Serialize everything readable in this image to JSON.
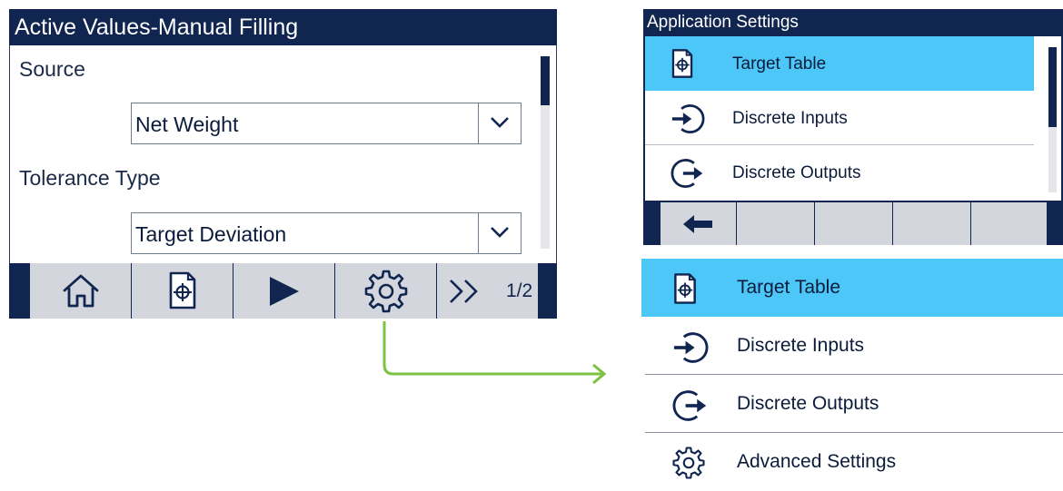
{
  "left_screen": {
    "title": "Active Values-Manual Filling",
    "fields": [
      {
        "label": "Source",
        "value": "Net Weight"
      },
      {
        "label": "Tolerance Type",
        "value": "Target Deviation"
      }
    ],
    "softkeys": [
      {
        "icon": "home-icon"
      },
      {
        "icon": "target-table-icon"
      },
      {
        "icon": "play-icon"
      },
      {
        "icon": "gear-icon"
      },
      {
        "icon": "double-chevron-right-icon",
        "page": "1/2"
      }
    ]
  },
  "right_screen": {
    "title": "Application Settings",
    "items": [
      {
        "label": "Target Table",
        "icon": "target-table-icon",
        "selected": true
      },
      {
        "label": "Discrete Inputs",
        "icon": "discrete-input-icon",
        "selected": false
      },
      {
        "label": "Discrete Outputs",
        "icon": "discrete-output-icon",
        "selected": false
      }
    ],
    "softkeys": [
      {
        "icon": "back-arrow-icon"
      }
    ]
  },
  "expanded_list": {
    "items": [
      {
        "label": "Target Table",
        "icon": "target-table-icon",
        "selected": true
      },
      {
        "label": "Discrete Inputs",
        "icon": "discrete-input-icon",
        "selected": false
      },
      {
        "label": "Discrete Outputs",
        "icon": "discrete-output-icon",
        "selected": false
      },
      {
        "label": "Advanced Settings",
        "icon": "gear-icon",
        "selected": false
      }
    ]
  },
  "colors": {
    "navy": "#10254f",
    "highlight": "#4cc7f8",
    "softkey": "#d3d7dd",
    "connector": "#7dc242"
  }
}
